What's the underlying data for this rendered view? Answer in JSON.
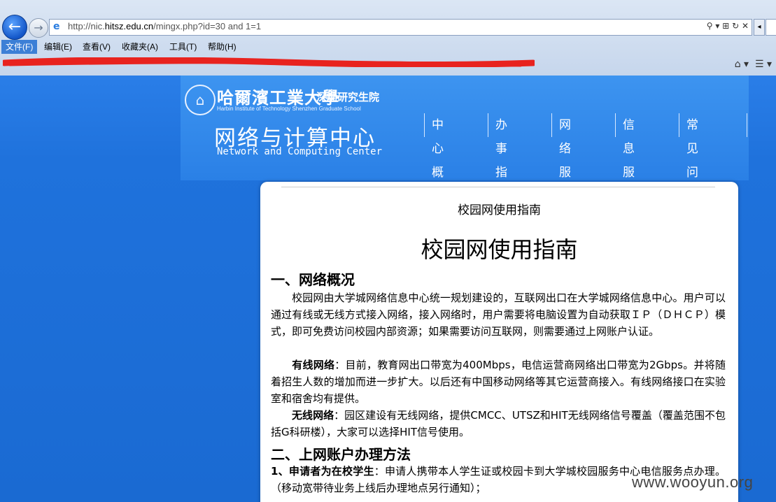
{
  "browser": {
    "url_prefix": "http://nic.",
    "url_host": "hitsz.edu.cn",
    "url_path": "/mingx.php?id=30 and 1=1",
    "addr_tools": "⚲ ▾ ⊞ ↻ ✕",
    "menu": [
      "文件(F)",
      "编辑(E)",
      "查看(V)",
      "收藏夹(A)",
      "工具(T)",
      "帮助(H)"
    ]
  },
  "site": {
    "logo_cn": "哈爾濱工業大學",
    "logo_sub": "深圳研究生院",
    "logo_en": "Harbin Institute of Technology Shenzhen Graduate School",
    "center_cn": "网络与计算中心",
    "center_en": "Network and Computing Center",
    "nav": [
      "中心概况",
      "办事指南",
      "网络服务",
      "信息服务",
      "常见问题"
    ]
  },
  "article": {
    "small_title": "校园网使用指南",
    "title": "校园网使用指南",
    "section1_heading": "一、网络概况",
    "p1": "校园网由大学城网络信息中心统一规划建设的，互联网出口在大学城网络信息中心。用户可以通过有线或无线方式接入网络，接入网络时，用户需要将电脑设置为自动获取ＩＰ（ＤＨＣＰ）模式，即可免费访问校园内部资源；如果需要访问互联网，则需要通过上网账户认证。",
    "p2_label": "有线网络",
    "p2": "：目前，教育网出口带宽为400Mbps，电信运营商网络出口带宽为2Gbps。并将随着招生人数的增加而进一步扩大。以后还有中国移动网络等其它运营商接入。有线网络接口在实验室和宿舍均有提供。",
    "p3_label": "无线网络",
    "p3": "：园区建设有无线网络，提供CMCC、UTSZ和HIT无线网络信号覆盖（覆盖范围不包括G科研楼），大家可以选择HIT信号使用。",
    "section2_heading": "二、上网账户办理方法",
    "p4_label": "1、申请者为在校学生",
    "p4": "：申请人携带本人学生证或校园卡到大学城校园服务中心电信服务点办理。（移动宽带待业务上线后办理地点另行通知）；"
  },
  "watermark": "www.wooyun.org"
}
